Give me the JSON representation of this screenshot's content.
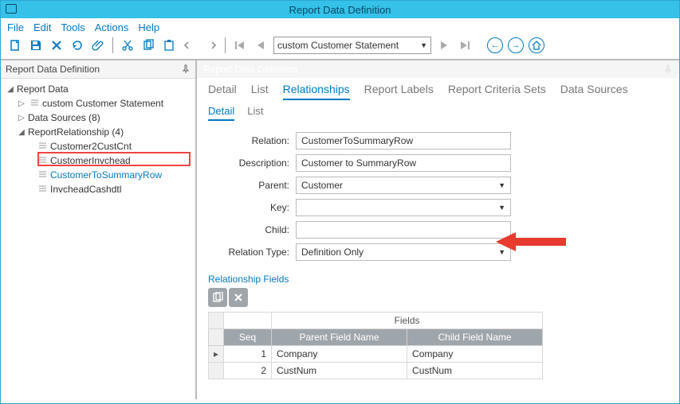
{
  "window": {
    "title": "Report Data Definition"
  },
  "menu": {
    "file": "File",
    "edit": "Edit",
    "tools": "Tools",
    "actions": "Actions",
    "help": "Help"
  },
  "toolbar": {
    "combo_value": "custom Customer Statement"
  },
  "left": {
    "header": "Report Data Definition",
    "root": "Report Data",
    "n1": "custom Customer Statement",
    "n2": "Data Sources (8)",
    "n3": "ReportRelationship (4)",
    "c1": "Customer2CustCnt",
    "c2": "CustomerInvchead",
    "c3": "CustomerToSummaryRow",
    "c4": "InvcheadCashdtl"
  },
  "right": {
    "header": "Report Data Definition",
    "tabs": {
      "detail": "Detail",
      "list": "List",
      "relationships": "Relationships",
      "labels": "Report Labels",
      "criteria": "Report Criteria Sets",
      "sources": "Data Sources"
    },
    "subtabs": {
      "detail": "Detail",
      "list": "List"
    },
    "form": {
      "relation_label": "Relation:",
      "relation_value": "CustomerToSummaryRow",
      "description_label": "Description:",
      "description_value": "Customer to SummaryRow",
      "parent_label": "Parent:",
      "parent_value": "Customer",
      "key_label": "Key:",
      "key_value": "",
      "child_label": "Child:",
      "child_value": "",
      "reltype_label": "Relation Type:",
      "reltype_value": "Definition Only"
    },
    "relfields": {
      "title": "Relationship Fields",
      "fields_head": "Fields",
      "col_seq": "Seq",
      "col_parent": "Parent Field Name",
      "col_child": "Child Field Name",
      "rows": [
        {
          "seq": "1",
          "parent": "Company",
          "child": "Company"
        },
        {
          "seq": "2",
          "parent": "CustNum",
          "child": "CustNum"
        }
      ]
    }
  }
}
